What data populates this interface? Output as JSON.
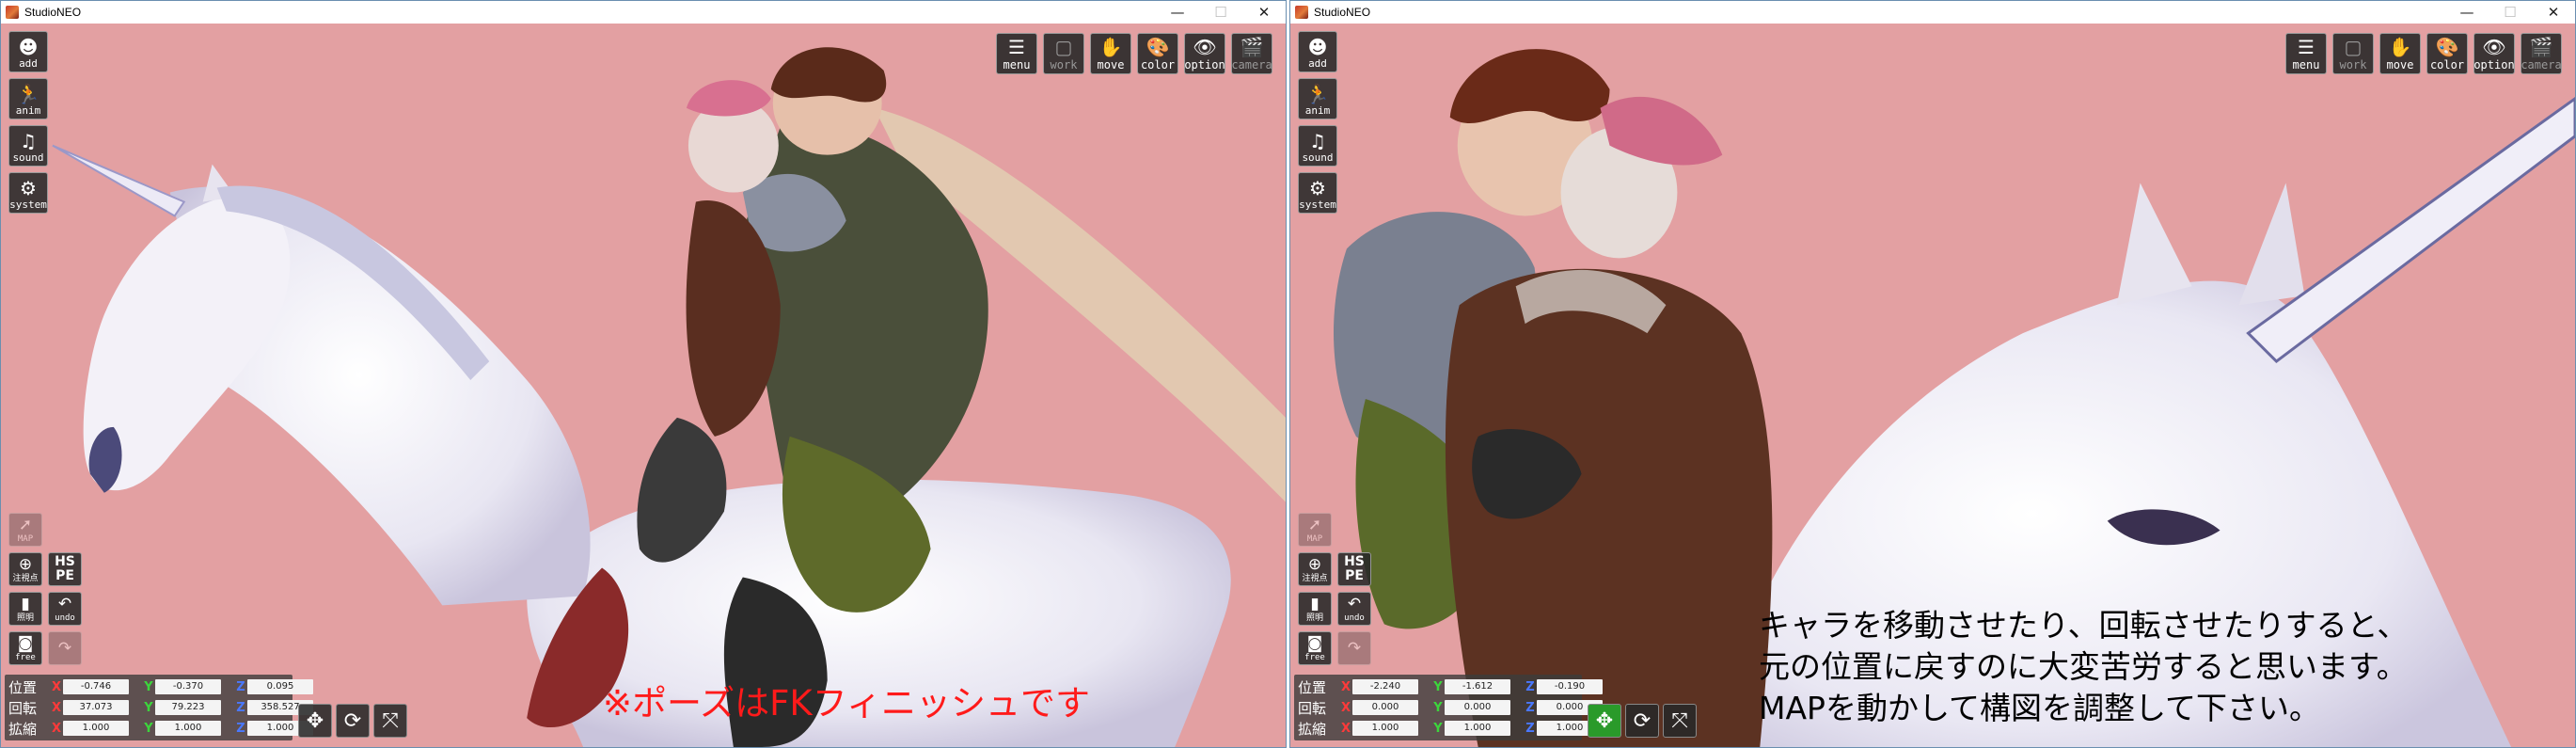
{
  "windows": [
    {
      "id": "left",
      "title": "StudioNEO",
      "controls": {
        "minimize": "—",
        "maximize": "☐",
        "close": "✕"
      },
      "left_buttons": [
        {
          "label": "add",
          "icon": "person-icon",
          "glyph": "☻"
        },
        {
          "label": "anim",
          "icon": "running-figure-icon",
          "glyph": "🏃"
        },
        {
          "label": "sound",
          "icon": "music-note-icon",
          "glyph": "♫"
        },
        {
          "label": "system",
          "icon": "gears-icon",
          "glyph": "⚙"
        }
      ],
      "side_tools": {
        "map": {
          "label": "MAP",
          "icon": "pointer-arrow-icon",
          "glyph": "➚"
        },
        "add_point": {
          "label": "注視点",
          "icon": "plus-circle-icon",
          "glyph": "⊕"
        },
        "hspe": {
          "label": "HS PE",
          "line1": "HS",
          "line2": "PE"
        },
        "lighting": {
          "label": "照明",
          "icon": "lamp-icon",
          "glyph": "▮"
        },
        "undo": {
          "label": "undo",
          "icon": "undo-arrow-icon",
          "glyph": "↶"
        },
        "free": {
          "label": "free",
          "icon": "camera-icon",
          "glyph": "◙"
        },
        "redo": {
          "label": "",
          "icon": "redo-arrow-icon",
          "glyph": "↷"
        }
      },
      "top_buttons": [
        {
          "label": "menu",
          "icon": "list-icon",
          "glyph": "☰",
          "dim": false
        },
        {
          "label": "work",
          "icon": "window-icon",
          "glyph": "▢",
          "dim": true
        },
        {
          "label": "move",
          "icon": "hand-icon",
          "glyph": "✋",
          "dim": false
        },
        {
          "label": "color",
          "icon": "palette-icon",
          "glyph": "🎨",
          "dim": false
        },
        {
          "label": "option",
          "icon": "eye-icon",
          "glyph": "👁",
          "dim": false
        },
        {
          "label": "camera",
          "icon": "clapper-icon",
          "glyph": "🎬",
          "dim": true
        }
      ],
      "transform": {
        "position": {
          "label": "位置",
          "x": "-0.746",
          "y": "-0.370",
          "z": "0.095"
        },
        "rotation": {
          "label": "回転",
          "x": "37.073",
          "y": "79.223",
          "z": "358.527"
        },
        "scale": {
          "label": "拡縮",
          "x": "1.000",
          "y": "1.000",
          "z": "1.000"
        }
      },
      "axes": {
        "x": "X",
        "y": "Y",
        "z": "Z"
      },
      "gizmo_buttons": [
        {
          "icon": "move-arrows-icon",
          "glyph": "✥",
          "active": false
        },
        {
          "icon": "rotate-icon",
          "glyph": "⟳",
          "active": false
        },
        {
          "icon": "scale-icon",
          "glyph": "⤧",
          "active": false
        }
      ],
      "caption": "※ポーズはFKフィニッシュです"
    },
    {
      "id": "right",
      "title": "StudioNEO",
      "controls": {
        "minimize": "—",
        "maximize": "☐",
        "close": "✕"
      },
      "left_buttons": [
        {
          "label": "add",
          "icon": "person-icon",
          "glyph": "☻"
        },
        {
          "label": "anim",
          "icon": "running-figure-icon",
          "glyph": "🏃"
        },
        {
          "label": "sound",
          "icon": "music-note-icon",
          "glyph": "♫"
        },
        {
          "label": "system",
          "icon": "gears-icon",
          "glyph": "⚙"
        }
      ],
      "side_tools": {
        "map": {
          "label": "MAP",
          "icon": "pointer-arrow-icon",
          "glyph": "➚"
        },
        "add_point": {
          "label": "注視点",
          "icon": "plus-circle-icon",
          "glyph": "⊕"
        },
        "hspe": {
          "label": "HS PE",
          "line1": "HS",
          "line2": "PE"
        },
        "lighting": {
          "label": "照明",
          "icon": "lamp-icon",
          "glyph": "▮"
        },
        "undo": {
          "label": "undo",
          "icon": "undo-arrow-icon",
          "glyph": "↶"
        },
        "free": {
          "label": "free",
          "icon": "camera-icon",
          "glyph": "◙"
        },
        "redo": {
          "label": "",
          "icon": "redo-arrow-icon",
          "glyph": "↷"
        }
      },
      "top_buttons": [
        {
          "label": "menu",
          "icon": "list-icon",
          "glyph": "☰",
          "dim": false
        },
        {
          "label": "work",
          "icon": "window-icon",
          "glyph": "▢",
          "dim": true
        },
        {
          "label": "move",
          "icon": "hand-icon",
          "glyph": "✋",
          "dim": false
        },
        {
          "label": "color",
          "icon": "palette-icon",
          "glyph": "🎨",
          "dim": false
        },
        {
          "label": "option",
          "icon": "eye-icon",
          "glyph": "👁",
          "dim": false
        },
        {
          "label": "camera",
          "icon": "clapper-icon",
          "glyph": "🎬",
          "dim": true
        }
      ],
      "transform": {
        "position": {
          "label": "位置",
          "x": "-2.240",
          "y": "-1.612",
          "z": "-0.190"
        },
        "rotation": {
          "label": "回転",
          "x": "0.000",
          "y": "0.000",
          "z": "0.000"
        },
        "scale": {
          "label": "拡縮",
          "x": "1.000",
          "y": "1.000",
          "z": "1.000"
        }
      },
      "axes": {
        "x": "X",
        "y": "Y",
        "z": "Z"
      },
      "gizmo_buttons": [
        {
          "icon": "move-arrows-icon",
          "glyph": "✥",
          "active": true
        },
        {
          "icon": "rotate-icon",
          "glyph": "⟳",
          "active": false
        },
        {
          "icon": "scale-icon",
          "glyph": "⤧",
          "active": false
        }
      ],
      "caption_lines": [
        "キャラを移動させたり、回転させたりすると、",
        "元の位置に戻すのに大変苦労すると思います。",
        "MAPを動かして構図を調整して下さい。"
      ]
    }
  ],
  "colors": {
    "viewport_bg": "#e3a0a2",
    "window_border": "#6a8fb0",
    "caption_left": "#ff1a1a",
    "caption_right": "#000000",
    "active_gizmo": "#2a9a2a"
  }
}
